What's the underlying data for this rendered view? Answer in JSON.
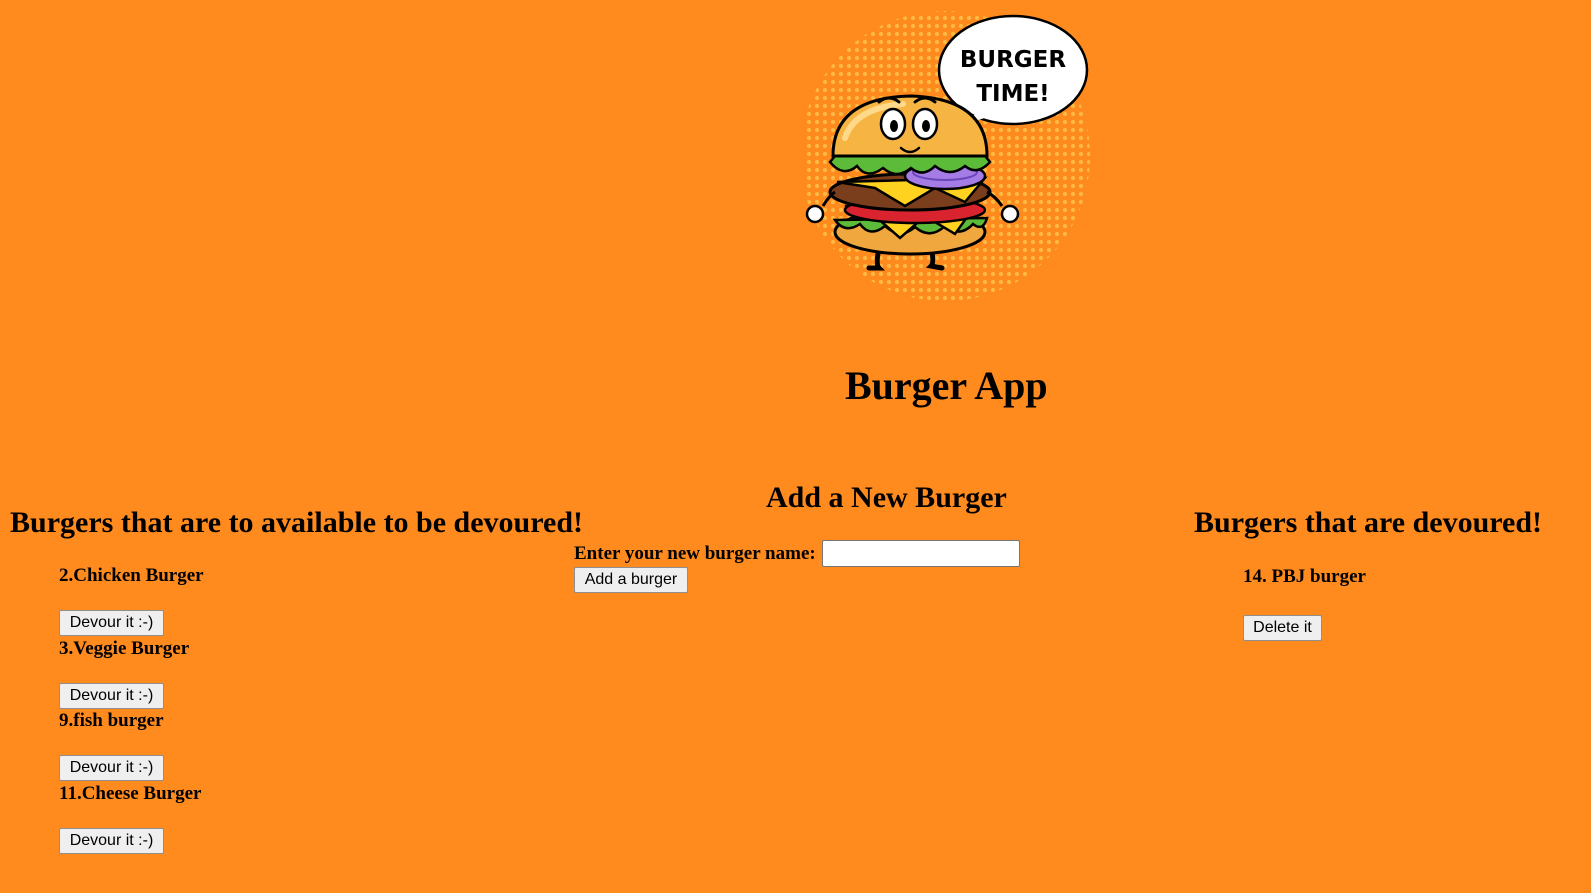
{
  "header": {
    "image_caption": "BURGER TIME!",
    "title": "Burger App"
  },
  "available": {
    "title": "Burgers that are to available to be devoured!",
    "items": [
      {
        "name": "2.Chicken Burger",
        "button": "Devour it :-)"
      },
      {
        "name": "3.Veggie Burger",
        "button": "Devour it :-)"
      },
      {
        "name": "9.fish burger",
        "button": "Devour it :-)"
      },
      {
        "name": "11.Cheese Burger",
        "button": "Devour it :-)"
      }
    ]
  },
  "add_form": {
    "title": "Add a New Burger",
    "label": "Enter your new burger name:",
    "input_value": "",
    "button": "Add a burger"
  },
  "devoured": {
    "title": "Burgers that are devoured!",
    "items": [
      {
        "name": "14. PBJ burger",
        "button": "Delete it"
      }
    ]
  },
  "colors": {
    "background": "#ff8a1e"
  }
}
